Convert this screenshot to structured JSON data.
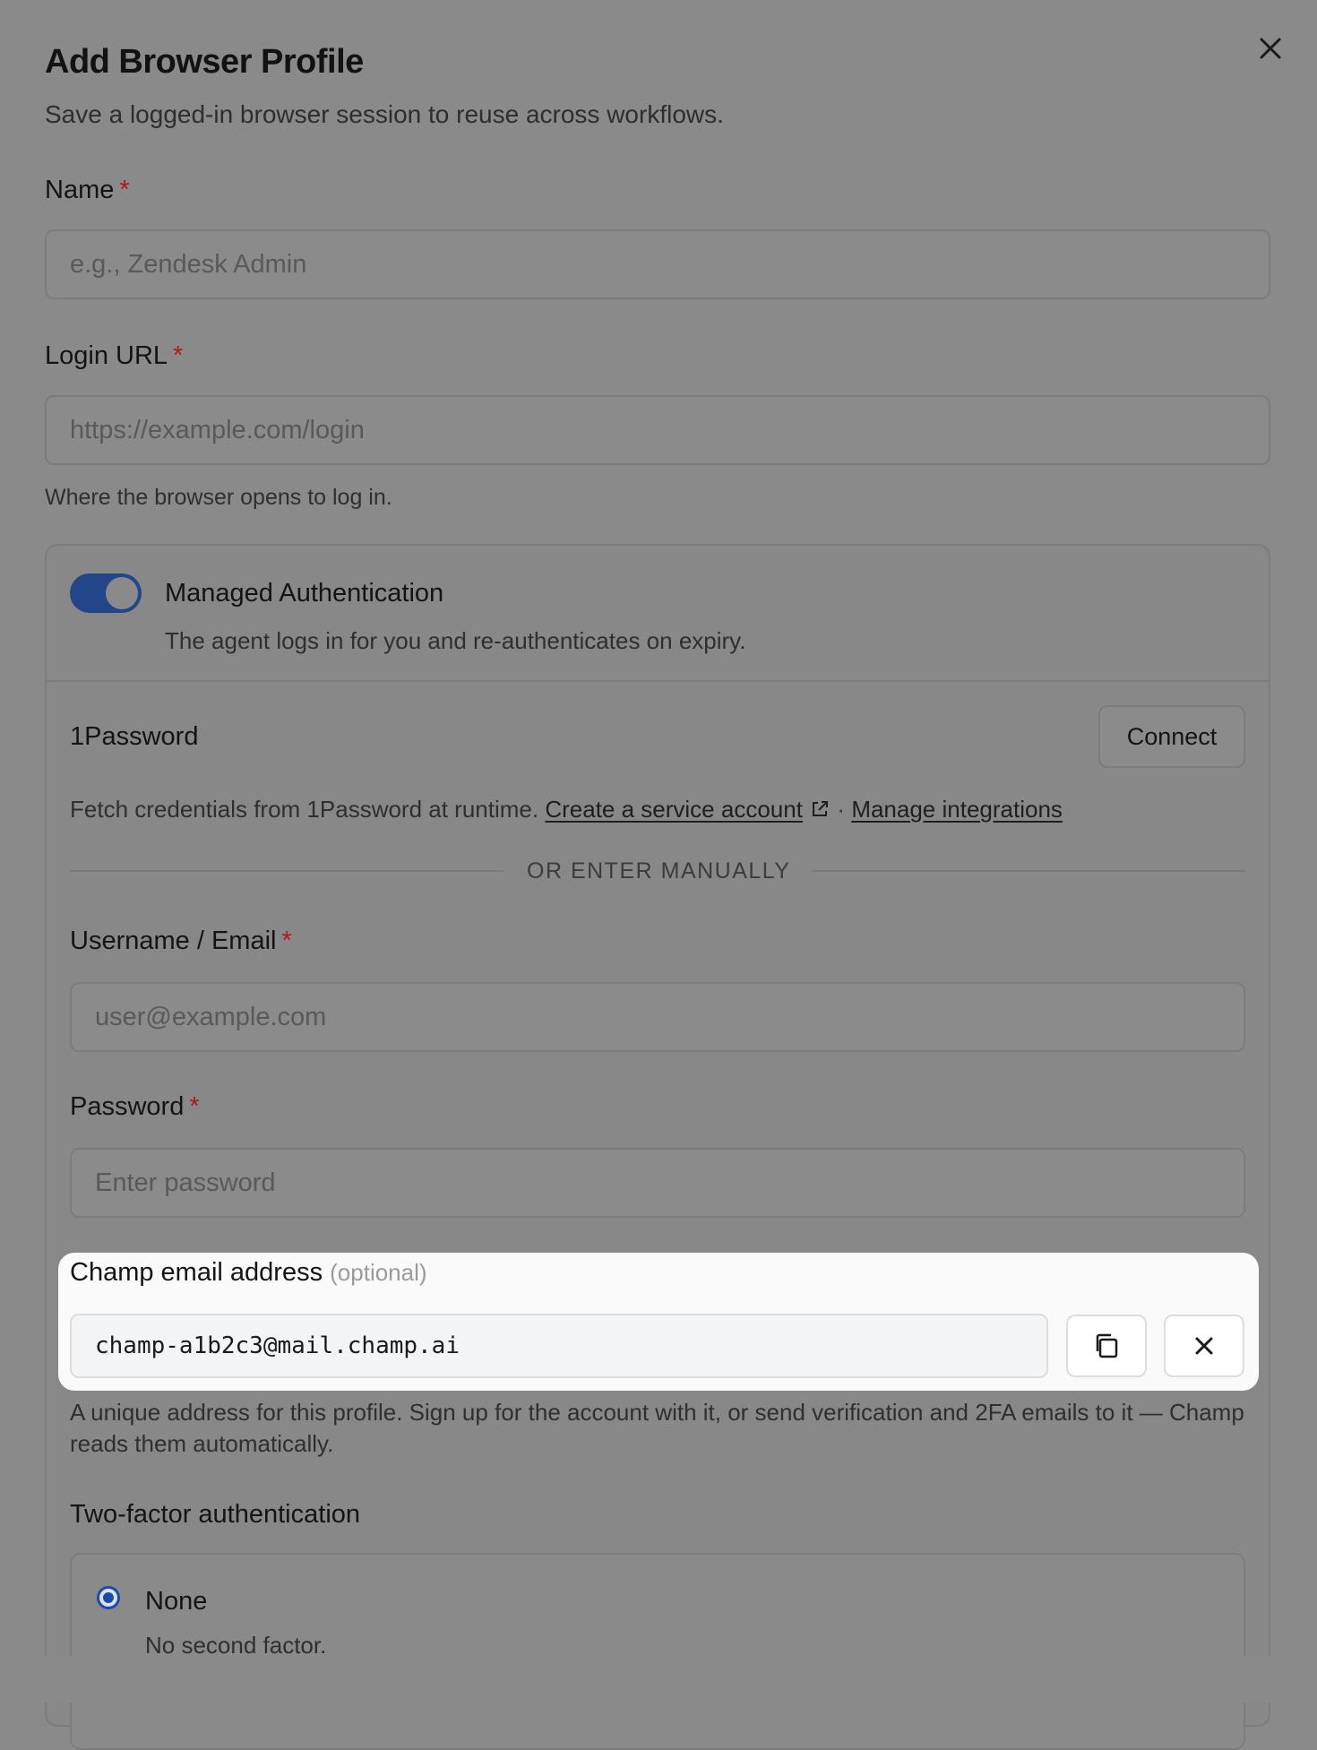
{
  "dialog": {
    "title": "Add Browser Profile",
    "subtitle": "Save a logged-in browser session to reuse across workflows."
  },
  "name_field": {
    "label": "Name",
    "required_mark": "*",
    "placeholder": "e.g., Zendesk Admin"
  },
  "login_url_field": {
    "label": "Login URL",
    "required_mark": "*",
    "placeholder": "https://example.com/login",
    "help": "Where the browser opens to log in."
  },
  "managed_auth": {
    "toggle_on": true,
    "label": "Managed Authentication",
    "description": "The agent logs in for you and re-authenticates on expiry."
  },
  "onepassword": {
    "title": "1Password",
    "connect_label": "Connect",
    "description": "Fetch credentials from 1Password at runtime.",
    "service_account_link": "Create a service account",
    "separator": "·",
    "manage_link": "Manage integrations"
  },
  "divider_text": "OR ENTER MANUALLY",
  "username_field": {
    "label": "Username / Email",
    "required_mark": "*",
    "placeholder": "user@example.com"
  },
  "password_field": {
    "label": "Password",
    "required_mark": "*",
    "placeholder": "Enter password"
  },
  "champ_email": {
    "label": "Champ email address",
    "optional": "(optional)",
    "value": "champ-a1b2c3@mail.champ.ai",
    "help": "A unique address for this profile. Sign up for the account with it, or send verification and 2FA emails to it — Champ reads them automatically."
  },
  "two_factor": {
    "label": "Two-factor authentication",
    "options": [
      {
        "label": "None",
        "description": "No second factor.",
        "selected": true
      }
    ]
  },
  "colors": {
    "overlay": "#8a8a8a",
    "accent": "#23458a",
    "required": "#b01919",
    "highlight": "#fafafa"
  }
}
